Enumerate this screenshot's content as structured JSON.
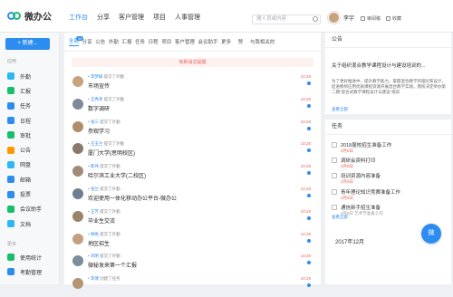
{
  "app": {
    "name": "微办公"
  },
  "nav": [
    "工作台",
    "分享",
    "客户管理",
    "项目",
    "人事管理"
  ],
  "search": {
    "placeholder": "搜人员或内容"
  },
  "user": {
    "name": "李宇",
    "icons": [
      "审阅稿",
      "收藏"
    ]
  },
  "sidebar": {
    "new_button": "+ 新建...",
    "section_apps": "应用",
    "items": [
      {
        "label": "外勤",
        "color": "#2db7f5"
      },
      {
        "label": "汇报",
        "color": "#19be6b"
      },
      {
        "label": "任务",
        "color": "#2d8cf0"
      },
      {
        "label": "日程",
        "color": "#2d8cf0"
      },
      {
        "label": "审批",
        "color": "#19be6b"
      },
      {
        "label": "公告",
        "color": "#ff9900"
      },
      {
        "label": "网盘",
        "color": "#2db7f5"
      },
      {
        "label": "邮箱",
        "color": "#2d8cf0"
      },
      {
        "label": "投票",
        "color": "#2d8cf0"
      },
      {
        "label": "会议助手",
        "color": "#19be6b"
      },
      {
        "label": "文档",
        "color": "#2db7f5"
      }
    ],
    "section_more": "更多",
    "items2": [
      {
        "label": "使用统计",
        "color": "#19be6b"
      },
      {
        "label": "考勤管理",
        "color": "#2d8cf0"
      }
    ]
  },
  "tabs": [
    "全部",
    "分享",
    "公告",
    "外勤",
    "汇报",
    "任务",
    "日程",
    "项目",
    "客户管理",
    "会议助手",
    "更多"
  ],
  "tabs_badge": "99",
  "tabs_extra": [
    "赞",
    "与我相关的"
  ],
  "notice": "有新消息提醒",
  "feed": [
    {
      "author": "李梦楠",
      "action": "提交了外勤",
      "title": "市场宣传",
      "time": "10:28",
      "color": "#c9a27e"
    },
    {
      "author": "王秀英",
      "action": "提交了外勤",
      "title": "数字调研",
      "time": "10:28",
      "color": "#7e8a9c"
    },
    {
      "author": "张三",
      "action": "提交了外勤",
      "title": "参观学习",
      "time": "10:28",
      "color": "#b08d6a"
    },
    {
      "author": "王玉兰",
      "action": "提交了外勤",
      "title": "厦门大学(思明校区)",
      "time": "10:28",
      "color": "#8b7a6b"
    },
    {
      "author": "陈伟",
      "action": "提交了外勤",
      "title": "哈尔滨工业大学(二校区)",
      "time": "10:28",
      "color": "#a48b75"
    },
    {
      "author": "张兰",
      "action": "提交了外勤",
      "title": "欢迎使用一体化移动办公平台-微办公",
      "time": "10:28",
      "color": "#6f7f91"
    },
    {
      "author": "王芳",
      "action": "提交了外勤",
      "title": "毕业生交流",
      "time": "10:28",
      "color": "#9c8468"
    },
    {
      "author": "杨帆",
      "action": "提交了外勤",
      "title": "地区招生",
      "time": "10:28",
      "color": "#c2a080"
    },
    {
      "author": "刘明",
      "action": "提交了外勤",
      "title": "微秘发来第一个汇报",
      "time": "10:28",
      "color": "#7d8c99"
    },
    {
      "author": "李博",
      "action": "创建了任务",
      "title": "",
      "time": "10:28",
      "color": "#b59473"
    }
  ],
  "announcement": {
    "heading": "公告",
    "title": "关于组织混合教学课程设计与建设培训的...",
    "body": "为了更好推进中，提升教学能力，掌握混合教学的理论和设计，促进教师应用优质课程资源开展混合教学实践，我校决定举办第二期\"混合式教学课程设计与建设\"培训",
    "more": "查看全部"
  },
  "tasks": {
    "heading": "任务",
    "items": [
      {
        "title": "2018届校招生准备工作",
        "date": "2月8日",
        "overdue": true
      },
      {
        "title": "调研会资料打印",
        "date": "2月8日",
        "overdue": true
      },
      {
        "title": "培训资源内容准备",
        "date": "2月8日",
        "overdue": true
      },
      {
        "title": "青年理论知识竞赛准备工作",
        "date": "2月8日",
        "overdue": true
      },
      {
        "title": "通信新手招生准备",
        "date": "2月8日 艺术节准备工作",
        "overdue": false
      }
    ],
    "more": "查看全部"
  },
  "calendar": {
    "label": "2017年12月"
  },
  "float_button": "微"
}
